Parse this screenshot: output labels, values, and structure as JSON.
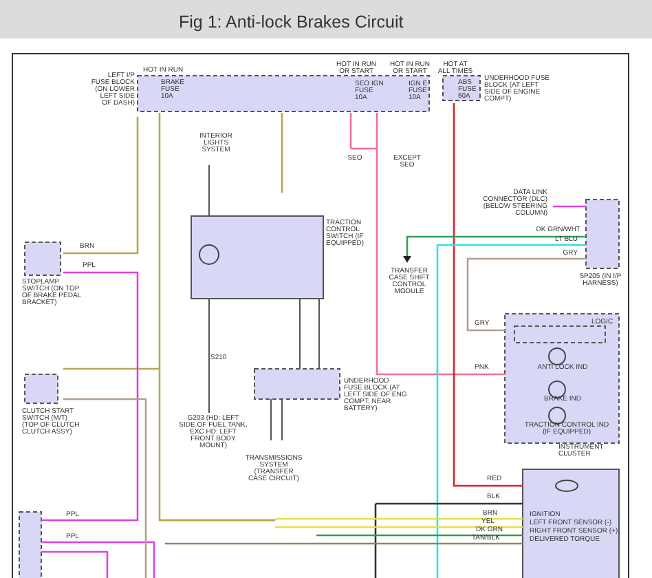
{
  "header": {
    "title": "Fig 1: Anti-lock Brakes Circuit"
  },
  "diagram": {
    "labels": [
      {
        "text": "HOT IN RUN"
      },
      {
        "text": "LEFT I/P FUSE BLOCK (ON LOWER LEFT SIDE OF DASH)"
      },
      {
        "text": "BRAKE FUSE 10A"
      },
      {
        "text": "HOT IN RUN OR START"
      },
      {
        "text": "SEO IGN FUSE 10A"
      },
      {
        "text": "HOT IN RUN OR START"
      },
      {
        "text": "IGN E FUSE 10A"
      },
      {
        "text": "HOT AT ALL TIMES"
      },
      {
        "text": "ABS FUSE 60A"
      },
      {
        "text": "UNDERHOOD FUSE BLOCK (AT LEFT SIDE OF ENGINE COMPT)"
      },
      {
        "text": "INTERIOR LIGHTS SYSTEM"
      },
      {
        "text": "SEO"
      },
      {
        "text": "EXCEPT SEO"
      },
      {
        "text": "TRACTION CONTROL SWITCH (IF EQUIPPED)"
      },
      {
        "text": "DATA LINK CONNECTOR (DLC) (BELOW STEERING COLUMN)"
      },
      {
        "text": "DK GRN/WHT"
      },
      {
        "text": "LT BLU"
      },
      {
        "text": "GRY"
      },
      {
        "text": "TRANSFER CASE SHIFT CONTROL MODULE"
      },
      {
        "text": "SP205 (IN I/P HARNESS)"
      },
      {
        "text": "STOPLAMP SWITCH (ON TOP OF BRAKE PEDAL BRACKET)"
      },
      {
        "text": "BRN"
      },
      {
        "text": "PPL"
      },
      {
        "text": "S210"
      },
      {
        "text": "UNDERHOOD FUSE BLOCK (AT LEFT SIDE OF ENG COMPT, NEAR BATTERY)"
      },
      {
        "text": "LOGIC"
      },
      {
        "text": "GRY"
      },
      {
        "text": "ANTI LOCK IND"
      },
      {
        "text": "PNK"
      },
      {
        "text": "BRAKE IND"
      },
      {
        "text": "TRACTION CONTROL IND (IF EQUIPPED)"
      },
      {
        "text": "INSTRUMENT CLUSTER"
      },
      {
        "text": "CLUTCH START SWITCH (M/T) (TOP OF CLUTCH CLUTCH ASSY)"
      },
      {
        "text": "G203 (HD: LEFT SIDE OF FUEL TANK, EXC HD: LEFT FRONT BODY MOUNT)"
      },
      {
        "text": "TRANSMISSIONS SYSTEM (TRANSFER CASE CIRCUIT)"
      },
      {
        "text": "RED"
      },
      {
        "text": "BLK"
      },
      {
        "text": "BRN"
      },
      {
        "text": "YEL"
      },
      {
        "text": "DK GRN"
      },
      {
        "text": "TAN/BLK"
      },
      {
        "text": "IGNITION"
      },
      {
        "text": "LEFT FRONT SENSOR (-)"
      },
      {
        "text": "RIGHT FRONT SENSOR (+)"
      },
      {
        "text": "DELIVERED TORQUE"
      },
      {
        "text": "PPL"
      },
      {
        "text": "PPL"
      }
    ]
  }
}
